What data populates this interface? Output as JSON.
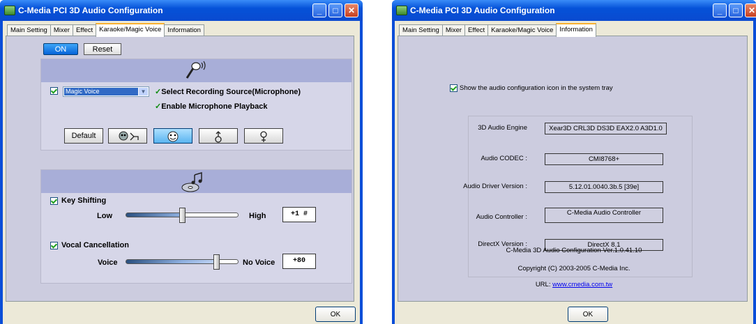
{
  "left_window": {
    "title": "C-Media PCI 3D Audio Configuration",
    "tabs": [
      "Main Setting",
      "Mixer",
      "Effect",
      "Karaoke/Magic Voice",
      "Information"
    ],
    "active_tab": "Karaoke/Magic Voice",
    "on_label": "ON",
    "reset_label": "Reset",
    "magic_voice": {
      "selected": "Magic Voice",
      "select_recording_label": "Select Recording Source(Microphone)",
      "enable_playback_label": "Enable Microphone Playback",
      "check_mark": "✓",
      "default_label": "Default"
    },
    "key_shifting": {
      "label": "Key Shifting",
      "low_label": "Low",
      "high_label": "High",
      "value": "+1 #",
      "position_fraction": 0.5
    },
    "vocal_cancellation": {
      "label": "Vocal Cancellation",
      "voice_label": "Voice",
      "no_voice_label": "No Voice",
      "value": "+80",
      "position_fraction": 0.8
    },
    "ok_label": "OK"
  },
  "right_window": {
    "title": "C-Media PCI 3D Audio Configuration",
    "tabs": [
      "Main Setting",
      "Mixer",
      "Effect",
      "Karaoke/Magic Voice",
      "Information"
    ],
    "active_tab": "Information",
    "tray_icon_label": "Show the audio configuration icon in the system tray",
    "rows": [
      {
        "label": "3D Audio Engine",
        "value": "Xear3D  CRL3D  DS3D  EAX2.0  A3D1.0"
      },
      {
        "label": "Audio CODEC :",
        "value": "CMI8768+"
      },
      {
        "label": "Audio Driver Version :",
        "value": "5.12.01.0040.3b.5 [39e]"
      },
      {
        "label": "Audio Controller :",
        "value": "C-Media Audio Controller"
      },
      {
        "label": "DirectX Version :",
        "value": "DirectX 8.1"
      }
    ],
    "version_text": "C-Media 3D Audio Configuration Ver.1.0.41.10",
    "copyright_text": "Copyright (C) 2003-2005 C-Media Inc.",
    "url_label": "URL:",
    "url_text": "www.cmedia.com.tw",
    "ok_label": "OK"
  },
  "window_controls": {
    "minimize": "_",
    "maximize": "□",
    "close": "✕"
  },
  "colors": {
    "titlebar": "#0552d8",
    "panel": "#ccccdf",
    "section_header": "#a8aed8",
    "on_button": "#0764d8"
  }
}
